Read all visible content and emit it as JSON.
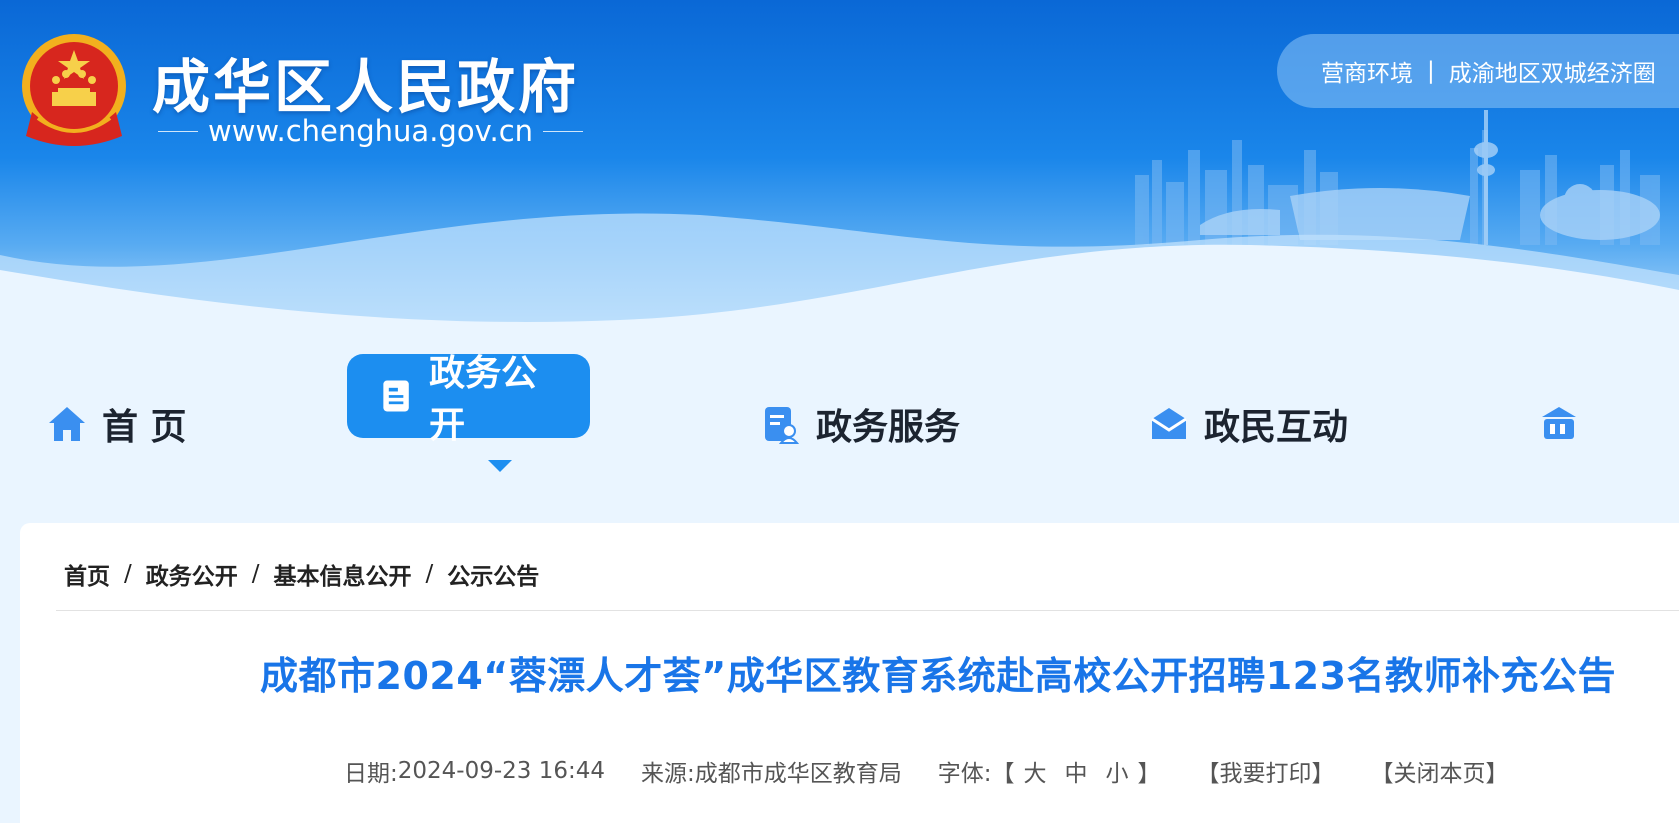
{
  "header": {
    "site_title": "成华区人民政府",
    "site_url": "www.chenghua.gov.cn",
    "top_links": [
      "营商环境",
      "成渝地区双城经济圈"
    ],
    "top_links_separator": "|"
  },
  "nav": {
    "items": [
      {
        "label": "首 页",
        "icon": "home-icon"
      },
      {
        "label": "政务公开",
        "icon": "document-icon",
        "active": true
      },
      {
        "label": "政务服务",
        "icon": "service-icon"
      },
      {
        "label": "政民互动",
        "icon": "mail-icon"
      }
    ],
    "active_color": "#1c8ef0"
  },
  "breadcrumb": {
    "items": [
      "首页",
      "政务公开",
      "基本信息公开",
      "公示公告"
    ],
    "separator": "/"
  },
  "article": {
    "title": "成都市2024“蓉漂人才荟”成华区教育系统赴高校公开招聘123名教师补充公告",
    "date_label": "日期:",
    "date": "2024-09-23 16:44",
    "source_label": "来源:",
    "source": "成都市成华区教育局",
    "font_label": "字体:",
    "font_open": "【",
    "font_close": "】",
    "font_sizes": [
      "大",
      "中",
      "小"
    ],
    "print_label": "【我要打印】",
    "close_label": "【关闭本页】"
  },
  "colors": {
    "banner_top": "#0a68d6",
    "title_blue": "#1975e8",
    "page_bg": "#eaf5ff"
  }
}
